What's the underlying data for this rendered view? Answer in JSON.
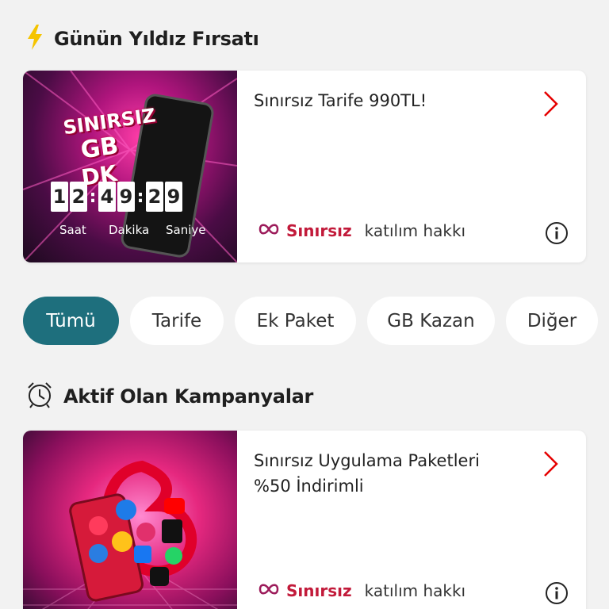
{
  "sections": {
    "deal_title": "Günün Yıldız Fırsatı",
    "active_title": "Aktif Olan Kampanyalar"
  },
  "deal_card": {
    "promo_lines": [
      "SINIRSIZ",
      "GB",
      "DK"
    ],
    "timer": {
      "hours": [
        "1",
        "2"
      ],
      "minutes": [
        "4",
        "9"
      ],
      "seconds": [
        "2",
        "9"
      ],
      "labels": {
        "hours": "Saat",
        "minutes": "Dakika",
        "seconds": "Saniye"
      }
    },
    "title": "Sınırsız Tarife 990TL!",
    "brand": "Sınırsız",
    "footer": "katılım hakkı"
  },
  "tabs": [
    {
      "label": "Tümü",
      "active": true
    },
    {
      "label": "Tarife",
      "active": false
    },
    {
      "label": "Ek Paket",
      "active": false
    },
    {
      "label": "GB Kazan",
      "active": false
    },
    {
      "label": "Diğer",
      "active": false
    }
  ],
  "active_card": {
    "title": "Sınırsız Uygulama Paketleri %50 İndirimli",
    "brand": "Sınırsız",
    "footer": "katılım hakkı"
  },
  "colors": {
    "accent_teal": "#1e6f7d",
    "brand_red": "#c21a3a",
    "bolt_yellow": "#f5c400",
    "arrow_red": "#e60000"
  },
  "icons": {
    "deal": "lightning-bolt-icon",
    "active": "alarm-clock-icon",
    "arrow": "chevron-right-icon",
    "info": "info-icon",
    "brand": "infinity-icon"
  }
}
